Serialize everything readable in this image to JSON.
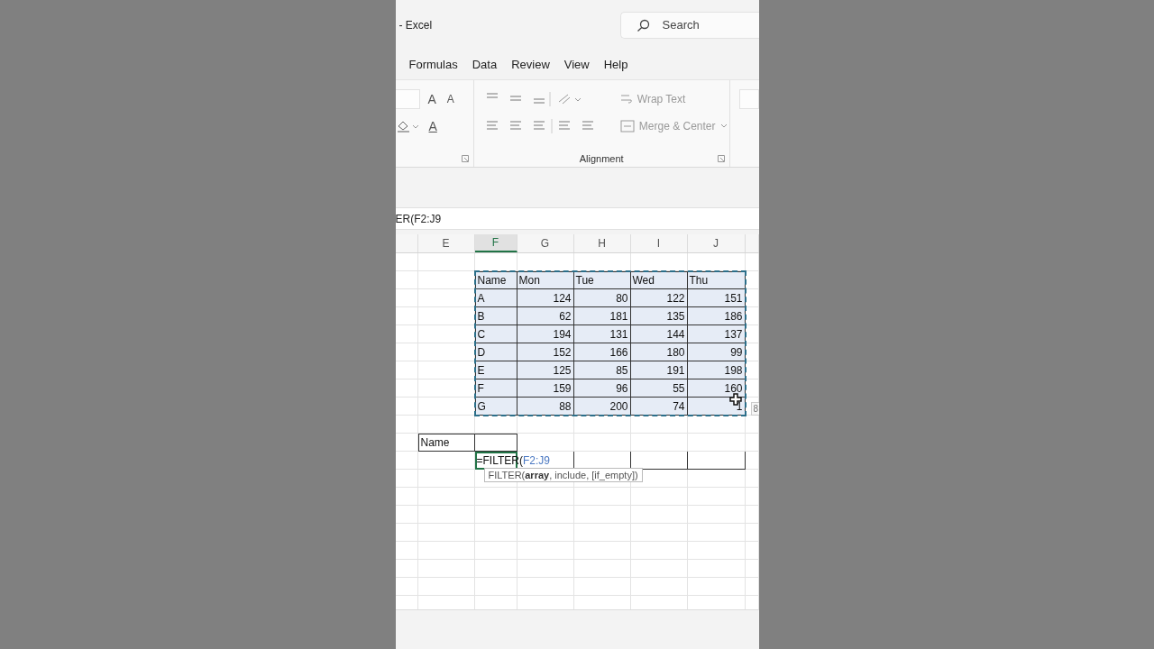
{
  "title": "- Excel",
  "search": {
    "placeholder": "Search"
  },
  "tabs": [
    {
      "label": "Formulas"
    },
    {
      "label": "Data"
    },
    {
      "label": "Review"
    },
    {
      "label": "View"
    },
    {
      "label": "Help"
    }
  ],
  "ribbon": {
    "font_buttons": [
      "A",
      "A"
    ],
    "font_color": "A",
    "wrap_text": "Wrap Text",
    "merge": "Merge & Center",
    "group_label": "Alignment"
  },
  "formula_bar": {
    "text": "ER(F2:J9"
  },
  "columns": [
    {
      "label": "E",
      "selected": false
    },
    {
      "label": "F",
      "selected": true
    },
    {
      "label": "G",
      "selected": false
    },
    {
      "label": "H",
      "selected": false
    },
    {
      "label": "I",
      "selected": false
    },
    {
      "label": "J",
      "selected": false
    }
  ],
  "table": {
    "header": [
      "Name",
      "Mon",
      "Tue",
      "Wed",
      "Thu"
    ],
    "rows": [
      [
        "A",
        "124",
        "80",
        "122",
        "151"
      ],
      [
        "B",
        "62",
        "181",
        "135",
        "186"
      ],
      [
        "C",
        "194",
        "131",
        "144",
        "137"
      ],
      [
        "D",
        "152",
        "166",
        "180",
        "99"
      ],
      [
        "E",
        "125",
        "85",
        "191",
        "198"
      ],
      [
        "F",
        "159",
        "96",
        "55",
        "160"
      ],
      [
        "G",
        "88",
        "200",
        "74",
        "1"
      ]
    ]
  },
  "criteria_label": "Name",
  "formula_cell": {
    "prefix": "=FILTER(",
    "ref": "F2:J9"
  },
  "tooltip": "FILTER(**array**, include, [if_empty])",
  "size_hint": "8"
}
